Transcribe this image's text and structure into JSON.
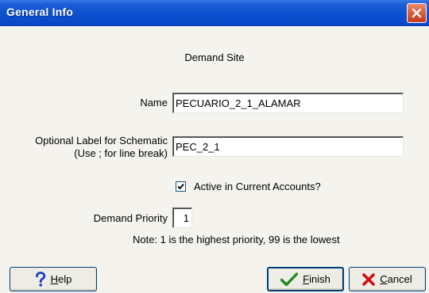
{
  "window": {
    "title": "General Info"
  },
  "form": {
    "section_label": "Demand Site",
    "name_label": "Name",
    "name_value": "PECUARIO_2_1_ALAMAR",
    "optional_label_line1": "Optional Label for Schematic",
    "optional_label_line2": "(Use ; for line break)",
    "optional_value": "PEC_2_1",
    "active_label": "Active in Current Accounts?",
    "active_checked": true,
    "priority_label": "Demand Priority",
    "priority_value": "1",
    "note": "Note: 1 is the highest priority, 99 is the lowest"
  },
  "buttons": {
    "help_first": "H",
    "help_rest": "elp",
    "finish_first": "F",
    "finish_rest": "inish",
    "cancel_first": "C",
    "cancel_rest": "ancel"
  },
  "icons": {
    "help": "question-mark-icon",
    "finish": "checkmark-icon",
    "cancel": "x-icon",
    "close": "close-icon"
  },
  "colors": {
    "titlebar": "#0a4fd0",
    "close_button": "#d95c3b",
    "help_icon": "#1a3fbf",
    "finish_icon": "#1f8a1f",
    "cancel_icon": "#d01010"
  }
}
